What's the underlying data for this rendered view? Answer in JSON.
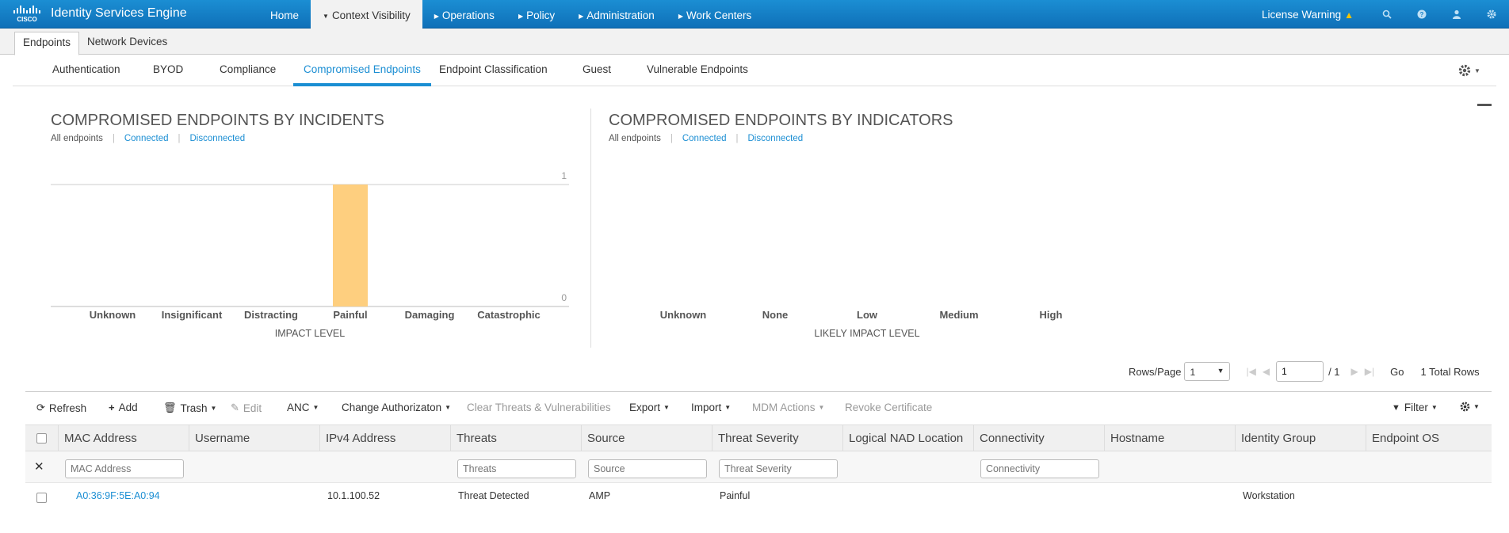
{
  "app": {
    "title": "Identity Services Engine"
  },
  "nav": {
    "home": "Home",
    "context_visibility": "Context Visibility",
    "operations": "Operations",
    "policy": "Policy",
    "administration": "Administration",
    "work_centers": "Work Centers",
    "license_warning": "License Warning"
  },
  "subtabs": {
    "endpoints": "Endpoints",
    "network_devices": "Network Devices"
  },
  "dashlet_tabs": [
    "Authentication",
    "BYOD",
    "Compliance",
    "Compromised Endpoints",
    "Endpoint Classification",
    "Guest",
    "Vulnerable Endpoints"
  ],
  "incidents_filters": {
    "all": "All endpoints",
    "connected": "Connected",
    "disconnected": "Disconnected"
  },
  "indicators_filters": {
    "all": "All endpoints",
    "connected": "Connected",
    "disconnected": "Disconnected"
  },
  "chart_data": [
    {
      "type": "bar",
      "title": "COMPROMISED ENDPOINTS BY INCIDENTS",
      "xlabel": "IMPACT LEVEL",
      "categories": [
        "Unknown",
        "Insignificant",
        "Distracting",
        "Painful",
        "Damaging",
        "Catastrophic"
      ],
      "values": [
        0,
        0,
        0,
        1,
        0,
        0
      ],
      "ylim": [
        0,
        1
      ],
      "yticks": [
        "0",
        "1"
      ],
      "color": "#fecf7f"
    },
    {
      "type": "bar",
      "title": "COMPROMISED ENDPOINTS BY INDICATORS",
      "xlabel": "LIKELY IMPACT LEVEL",
      "categories": [
        "Unknown",
        "None",
        "Low",
        "Medium",
        "High"
      ],
      "values": [
        0,
        0,
        0,
        0,
        0
      ]
    }
  ],
  "pagination": {
    "rows_label": "Rows/Page",
    "rows_value": "1",
    "page_value": "1",
    "of_pages": "/ 1",
    "go": "Go",
    "total": "1 Total Rows"
  },
  "toolbar": {
    "refresh": "Refresh",
    "add": "Add",
    "trash": "Trash",
    "edit": "Edit",
    "anc": "ANC",
    "change_authz": "Change Authorizaton",
    "clear_threats": "Clear Threats & Vulnerabilities",
    "export": "Export",
    "import": "Import",
    "mdm_actions": "MDM Actions",
    "revoke_cert": "Revoke Certificate",
    "filter": "Filter"
  },
  "table": {
    "columns": [
      "MAC Address",
      "Username",
      "IPv4 Address",
      "Threats",
      "Source",
      "Threat Severity",
      "Logical NAD Location",
      "Connectivity",
      "Hostname",
      "Identity Group",
      "Endpoint OS"
    ],
    "filter_placeholders": {
      "mac": "MAC Address",
      "threats": "Threats",
      "source": "Source",
      "severity": "Threat Severity",
      "connectivity": "Connectivity"
    },
    "rows": [
      {
        "mac": "A0:36:9F:5E:A0:94",
        "ipv4": "10.1.100.52",
        "threats": "Threat Detected",
        "source": "AMP",
        "severity": "Painful",
        "identity_group": "Workstation"
      }
    ]
  },
  "colors": {
    "accent": "#1b8ed3",
    "bar": "#fecf7f",
    "warning": "#f5c400"
  }
}
